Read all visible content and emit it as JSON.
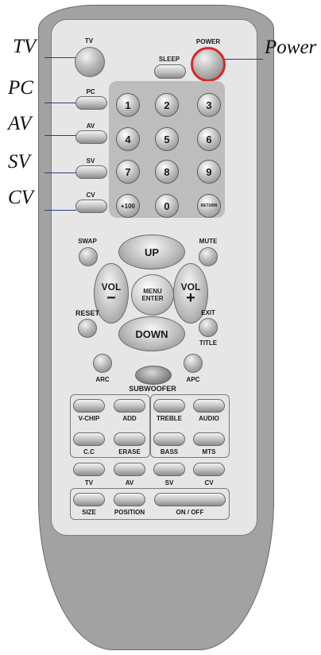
{
  "callouts": {
    "tv": "TV",
    "pc": "PC",
    "av": "AV",
    "sv": "SV",
    "cv": "CV",
    "power": "Power"
  },
  "keys": {
    "tv": "TV",
    "pc": "PC",
    "av": "AV",
    "sv": "SV",
    "cv": "CV",
    "sleep": "SLEEP",
    "power": "POWER",
    "digits": [
      "1",
      "2",
      "3",
      "4",
      "5",
      "6",
      "7",
      "8",
      "9"
    ],
    "plus100": "+100",
    "zero": "0",
    "return": "RETURN",
    "swap": "SWAP",
    "mute": "MUTE",
    "up": "UP",
    "down": "DOWN",
    "vol": "VOL",
    "vol_minus": "−",
    "vol_plus": "+",
    "menu": "MENU",
    "enter": "ENTER",
    "reset": "RESET",
    "exit": "EXIT",
    "title": "TITLE",
    "arc": "ARC",
    "apc": "APC",
    "subwoofer": "SUBWOOFER",
    "vchip": "V-CHIP",
    "add": "ADD",
    "cc": "C.C",
    "erase": "ERASE",
    "treble": "TREBLE",
    "audio": "AUDIO",
    "bass": "BASS",
    "mts": "MTS",
    "source_tv": "TV",
    "source_av": "AV",
    "source_sv": "SV",
    "source_cv": "CV",
    "size": "SIZE",
    "position": "POSITION",
    "onoff": "ON / OFF"
  },
  "colors": {
    "power_ring": "#d9262b",
    "leader_line": "#2b3a8c",
    "remote_body": "#a2a2a2",
    "panel": "#e6e6e6"
  }
}
